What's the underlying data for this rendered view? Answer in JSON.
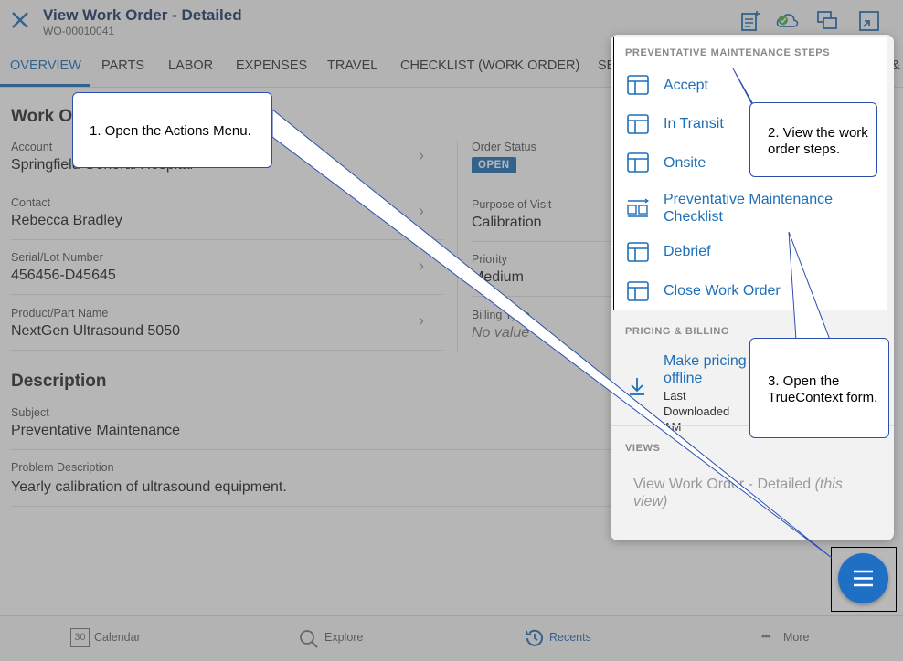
{
  "header": {
    "title": "View Work Order - Detailed",
    "subtitle": "WO-00010041",
    "icons": [
      "close-icon",
      "add-note-icon",
      "cloud-sync-icon",
      "chat-icon",
      "collapse-icon"
    ]
  },
  "tabs": [
    {
      "label": "OVERVIEW",
      "active": true
    },
    {
      "label": "PARTS"
    },
    {
      "label": "LABOR"
    },
    {
      "label": "EXPENSES"
    },
    {
      "label": "TRAVEL"
    },
    {
      "label": "CHECKLIST (WORK ORDER)"
    },
    {
      "label": "SE"
    },
    {
      "label": "&"
    }
  ],
  "main": {
    "section_title": "Work O",
    "left_fields": [
      {
        "label": "Account",
        "value": "Springfield General Hospital"
      },
      {
        "label": "Contact",
        "value": "Rebecca Bradley"
      },
      {
        "label": "Serial/Lot Number",
        "value": "456456-D45645"
      },
      {
        "label": "Product/Part Name",
        "value": "NextGen Ultrasound 5050"
      }
    ],
    "right_fields": [
      {
        "label": "Order Status",
        "value": "OPEN"
      },
      {
        "label": "Purpose of Visit",
        "value": "Calibration"
      },
      {
        "label": "Priority",
        "value": "Medium"
      },
      {
        "label": "Billing Type",
        "value": "No value"
      }
    ],
    "description_title": "Description",
    "description_fields": [
      {
        "label": "Subject",
        "value": "Preventative Maintenance"
      },
      {
        "label": "Problem Description",
        "value": "Yearly calibration of ultrasound equipment."
      }
    ]
  },
  "actions_panel": {
    "steps_heading": "PREVENTATIVE MAINTENANCE STEPS",
    "steps": [
      {
        "label": "Accept",
        "icon": "table-icon"
      },
      {
        "label": "In Transit",
        "icon": "table-icon"
      },
      {
        "label": "Onsite",
        "icon": "table-icon"
      },
      {
        "label": "Preventative Maintenance Checklist",
        "icon": "checklist-icon"
      },
      {
        "label": "Debrief",
        "icon": "table-icon"
      },
      {
        "label": "Close Work Order",
        "icon": "table-icon"
      }
    ],
    "pricing_heading": "PRICING & BILLING",
    "pricing_item": {
      "label": "Make pricing offline",
      "sub": "Last Downloaded AM",
      "icon": "download-icon"
    },
    "views_heading": "VIEWS",
    "views_item": {
      "label": "View Work Order - Detailed",
      "suffix": "(this view)"
    }
  },
  "bottom_nav": [
    {
      "label": "Calendar",
      "icon": "calendar-icon",
      "icon_text": "30"
    },
    {
      "label": "Explore",
      "icon": "search-icon"
    },
    {
      "label": "Recents",
      "icon": "clock-icon",
      "active": true
    },
    {
      "label": "More",
      "icon": "more-icon",
      "icon_text": "•••"
    }
  ],
  "callouts": [
    "1. Open the Actions Menu.",
    "2. View the work order steps.",
    "3. Open the TrueContext form."
  ],
  "colors": {
    "accent": "#1e6fb8",
    "fab": "#1f6fc4",
    "callout_border": "#2a4fb0"
  }
}
